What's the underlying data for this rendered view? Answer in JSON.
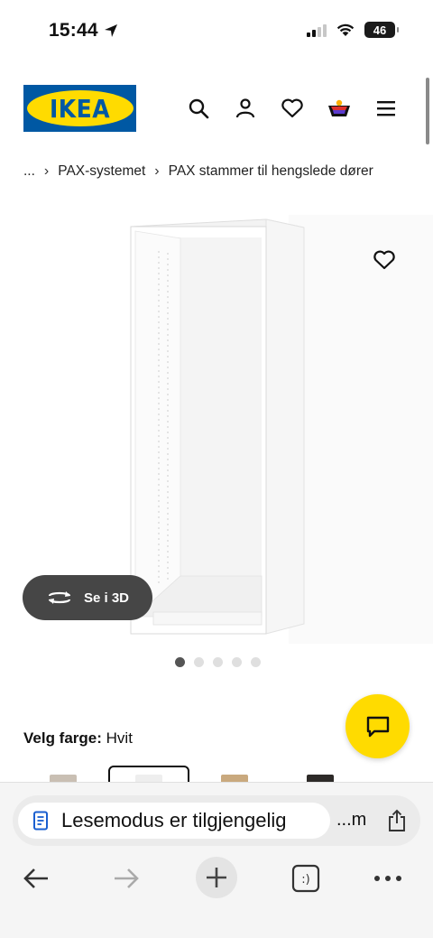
{
  "status": {
    "time": "15:44",
    "battery": "46"
  },
  "header": {
    "logo_text": "IKEA",
    "colors": {
      "brand_blue": "#0058a3",
      "brand_yellow": "#ffdb00"
    },
    "icons": [
      "search-icon",
      "account-icon",
      "favorites-icon",
      "cart-icon",
      "menu-icon"
    ]
  },
  "breadcrumb": {
    "ellipsis": "...",
    "items": [
      "PAX-systemet",
      "PAX stammer til hengslede dører"
    ],
    "separator": "›"
  },
  "gallery": {
    "view_3d_label": "Se i 3D",
    "dots_count": 5,
    "active_dot": 1
  },
  "color_picker": {
    "label": "Velg farge:",
    "value": "Hvit",
    "swatch_colors": [
      "#c9bfb3",
      "#f2f2f2",
      "#c9a97e",
      "#2d2a28"
    ]
  },
  "browser": {
    "reader_text": "Lesemodus er tilgjengelig",
    "url_short": "...m",
    "nav": [
      "back-icon",
      "forward-icon",
      "new-tab-icon",
      "tabs-icon",
      "more-icon"
    ],
    "tabs_glyph": ":)"
  }
}
